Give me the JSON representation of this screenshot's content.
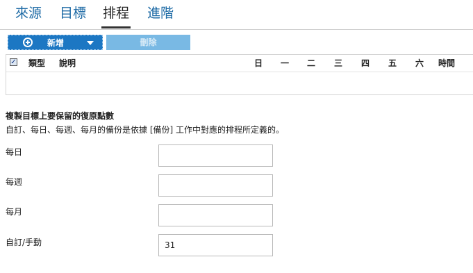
{
  "tabs": [
    {
      "label": "來源"
    },
    {
      "label": "目標"
    },
    {
      "label": "排程"
    },
    {
      "label": "進階"
    }
  ],
  "toolbar": {
    "add_label": "新增",
    "delete_label": "刪除"
  },
  "grid": {
    "check_mark": "✓",
    "columns": {
      "type": "類型",
      "description": "說明",
      "sun": "日",
      "mon": "一",
      "tue": "二",
      "wed": "三",
      "thu": "四",
      "fri": "五",
      "sat": "六",
      "time": "時間"
    }
  },
  "retention": {
    "title": "複製目標上要保留的復原點數",
    "description": "自訂、每日、每週、每月的備份是依據 [備份] 工作中對應的排程所定義的。",
    "daily": {
      "label": "每日",
      "value": ""
    },
    "weekly": {
      "label": "每週",
      "value": ""
    },
    "monthly": {
      "label": "每月",
      "value": ""
    },
    "custom": {
      "label": "自訂/手動",
      "value": "31"
    }
  },
  "colors": {
    "tab_link": "#1d6aa5",
    "add_button": "#1c77c3",
    "delete_button_disabled": "#79b9e4"
  }
}
